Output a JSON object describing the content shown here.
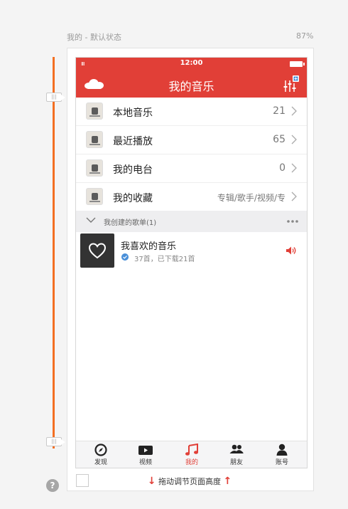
{
  "header": {
    "title": "我的 - 默认状态",
    "zoom": "87%"
  },
  "rail": {
    "handle_glyph": "|||",
    "help": "?"
  },
  "phone": {
    "statusbar": {
      "signal": "ııı",
      "time": "12:00"
    },
    "navbar": {
      "title": "我的音乐"
    },
    "rows": [
      {
        "label": "本地音乐",
        "value": "21"
      },
      {
        "label": "最近播放",
        "value": "65"
      },
      {
        "label": "我的电台",
        "value": "0"
      },
      {
        "label": "我的收藏",
        "value": "专辑/歌手/视频/专"
      }
    ],
    "group": {
      "label": "我创建的歌单(1)"
    },
    "playlist": {
      "title": "我喜欢的音乐",
      "subtitle": "37首，已下载21首"
    },
    "tabs": [
      {
        "label": "发现",
        "icon": "discover-icon"
      },
      {
        "label": "视频",
        "icon": "video-icon"
      },
      {
        "label": "我的",
        "icon": "music-note-icon"
      },
      {
        "label": "朋友",
        "icon": "friends-icon"
      },
      {
        "label": "账号",
        "icon": "account-icon"
      }
    ],
    "active_tab": "我的"
  },
  "footer": {
    "text": "拖动调节页面高度",
    "down_arrow": "↓",
    "up_arrow": "↑"
  },
  "colors": {
    "brand": "#e13f37",
    "rail": "#f36f22"
  }
}
